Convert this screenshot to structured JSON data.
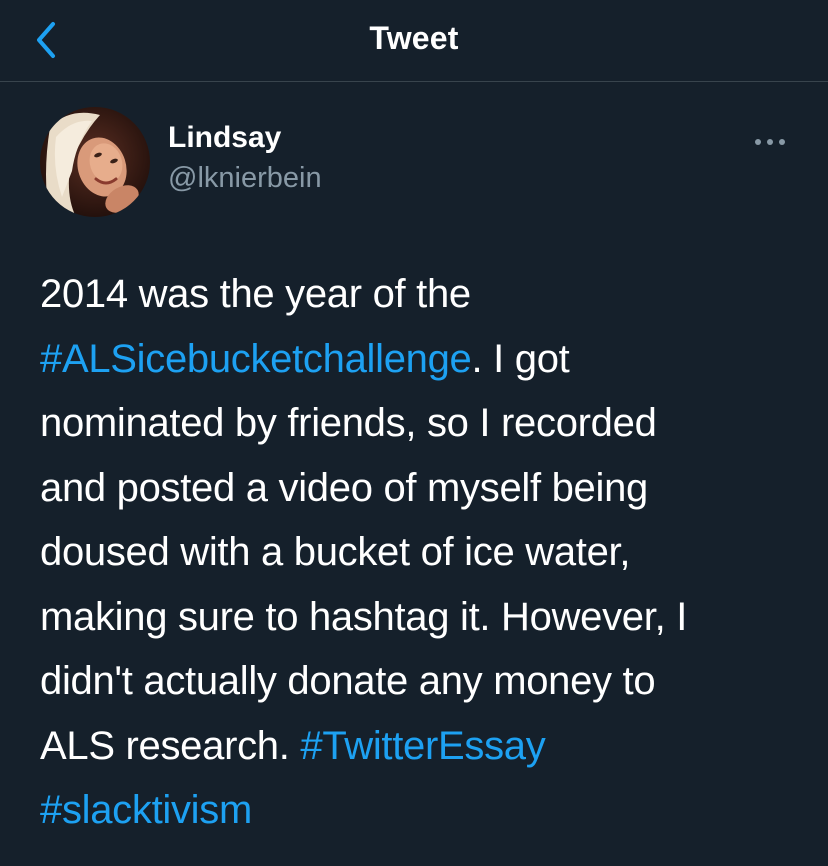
{
  "header": {
    "title": "Tweet",
    "back_icon": "chevron-left-icon"
  },
  "tweet": {
    "author": {
      "display_name": "Lindsay",
      "handle": "@lknierbein",
      "avatar_icon": "avatar-photo"
    },
    "more_icon": "more-horizontal-icon",
    "lines": [
      {
        "parts": [
          {
            "text": "2014 was the year of the",
            "type": "text"
          }
        ]
      },
      {
        "parts": [
          {
            "text": "#ALSicebucketchallenge",
            "type": "hashtag"
          },
          {
            "text": ". I got",
            "type": "text"
          }
        ]
      },
      {
        "parts": [
          {
            "text": "nominated by friends, so I recorded",
            "type": "text"
          }
        ]
      },
      {
        "parts": [
          {
            "text": "and posted a video of myself being",
            "type": "text"
          }
        ]
      },
      {
        "parts": [
          {
            "text": "doused with a bucket of ice water,",
            "type": "text"
          }
        ]
      },
      {
        "parts": [
          {
            "text": "making sure to hashtag it. However, I",
            "type": "text"
          }
        ]
      },
      {
        "parts": [
          {
            "text": "didn't actually donate any money to",
            "type": "text"
          }
        ]
      },
      {
        "parts": [
          {
            "text": "ALS research. ",
            "type": "text"
          },
          {
            "text": "#TwitterEssay",
            "type": "hashtag"
          }
        ]
      },
      {
        "parts": [
          {
            "text": "#slacktivism",
            "type": "hashtag"
          }
        ]
      }
    ]
  },
  "colors": {
    "background": "#15202b",
    "accent": "#1da1f2",
    "secondary_text": "#8899a6",
    "divider": "#38444d"
  }
}
